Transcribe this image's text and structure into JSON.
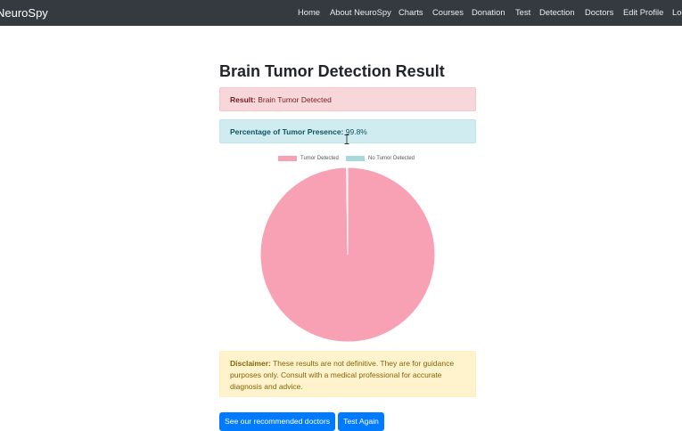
{
  "navbar": {
    "brand": "NeuroSpy",
    "items": [
      "Home",
      "About NeuroSpy",
      "Charts",
      "Courses",
      "Donation",
      "Test",
      "Detection",
      "Doctors",
      "Edit Profile",
      "Logout"
    ]
  },
  "page": {
    "title": "Brain Tumor Detection Result"
  },
  "result": {
    "label": "Result:",
    "value": "Brain Tumor Detected"
  },
  "percentage": {
    "label": "Percentage of Tumor Presence:",
    "value": "99.8%"
  },
  "chart_data": {
    "type": "pie",
    "categories": [
      "Tumor Detected",
      "No Tumor Detected"
    ],
    "values": [
      99.8,
      0.2
    ],
    "colors": [
      "#f8a1b4",
      "#a8d8dc"
    ],
    "legend_position": "top"
  },
  "disclaimer": {
    "label": "Disclaimer:",
    "text": "These results are not definitive. They are for guidance purposes only. Consult with a medical professional for accurate diagnosis and advice."
  },
  "buttons": {
    "doctors": "See our recommended doctors",
    "test_again": "Test Again"
  },
  "colors": {
    "navbar": "#343a40",
    "primary": "#007bff"
  }
}
